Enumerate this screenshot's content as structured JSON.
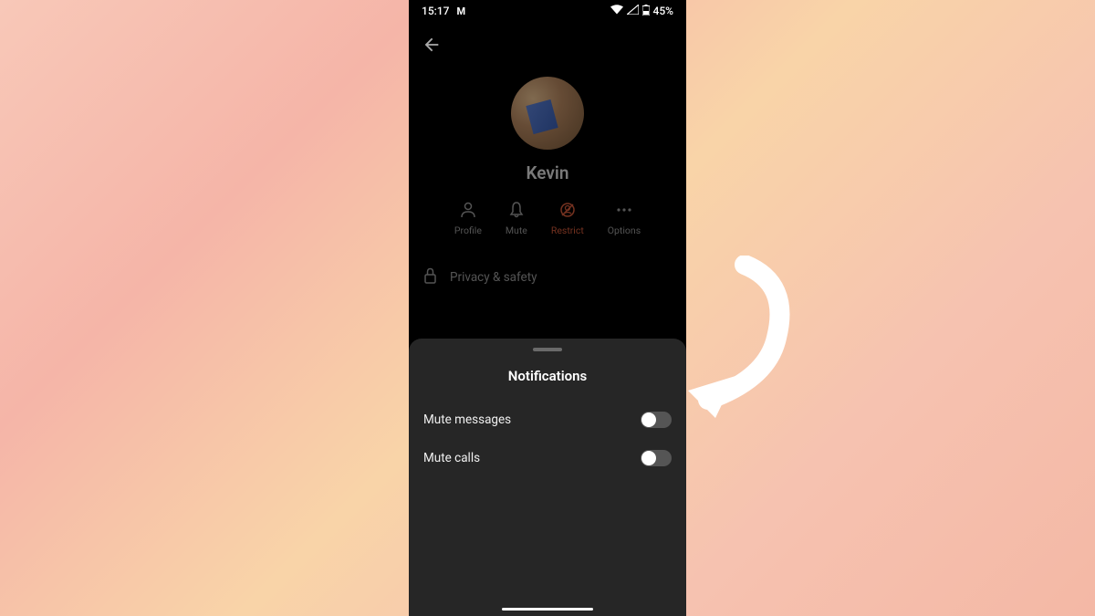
{
  "status": {
    "time": "15:17",
    "battery": "45%"
  },
  "profile": {
    "name": "Kevin"
  },
  "actions": {
    "profile": "Profile",
    "mute": "Mute",
    "restrict": "Restrict",
    "options": "Options"
  },
  "privacy": {
    "label": "Privacy & safety"
  },
  "sheet": {
    "title": "Notifications",
    "mute_messages": "Mute messages",
    "mute_calls": "Mute calls"
  }
}
